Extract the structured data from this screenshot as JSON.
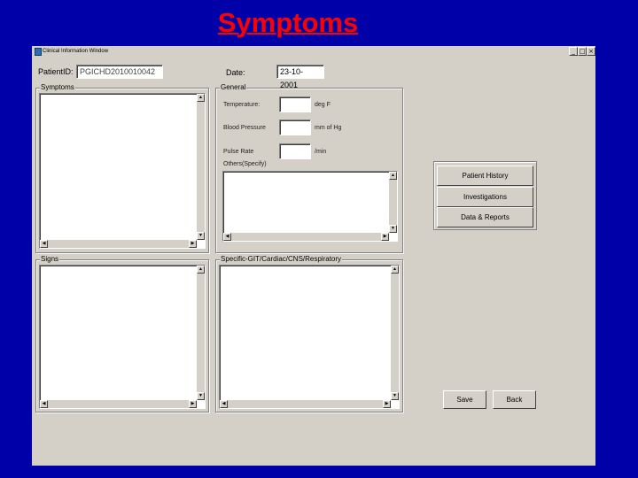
{
  "slide": {
    "title": "Symptoms"
  },
  "window": {
    "title": "Clinical Information Window",
    "min": "_",
    "max": "□",
    "close": "×"
  },
  "form": {
    "patient_id_label": "PatientID:",
    "patient_id_value": "PGICHD2010010042",
    "date_label": "Date:",
    "date_value": "23-10-2001"
  },
  "groups": {
    "symptoms": "Symptoms",
    "general": "General",
    "signs": "Signs",
    "specific": "Specific-GIT/Cardiac/CNS/Respiratory"
  },
  "general": {
    "temperature_label": "Temperature:",
    "temperature_unit": "deg F",
    "bp_label": "Blood Pressure",
    "bp_unit": "mm of Hg",
    "pulse_label": "Pulse Rate",
    "pulse_unit": "/min",
    "others_label": "Others(Specify)"
  },
  "buttons": {
    "patient_history": "Patient History",
    "investigations": "Investigations",
    "data_reports": "Data & Reports",
    "save": "Save",
    "back": "Back"
  },
  "scroll_glyphs": {
    "up": "▲",
    "down": "▼",
    "left": "◀",
    "right": "▶"
  }
}
